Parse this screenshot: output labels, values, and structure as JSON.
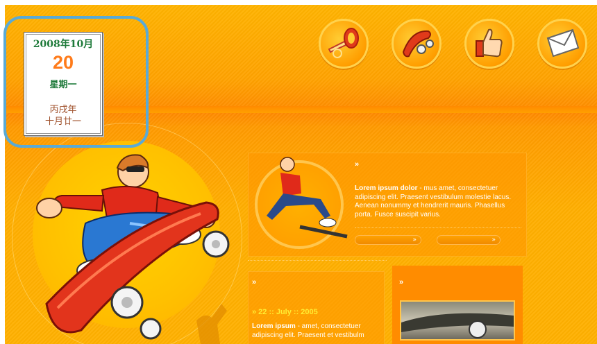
{
  "header": {
    "icons": [
      "trumpet-icon",
      "skateboard-icon",
      "thumbs-up-icon",
      "envelope-icon"
    ]
  },
  "calendar": {
    "year_month": "2008年10月",
    "day": "20",
    "weekday": "星期一",
    "lunar_year": "丙戌年",
    "lunar_date": "十月廿一"
  },
  "content": {
    "block1": {
      "arrow": "»",
      "bold": "Lorem ipsum dolor",
      "text": " - mus amet, consectetuer adipiscing elit. Praesent vestibulum molestie lacus. Aenean nonummy et hendrerit mauris. Phasellus porta. Fusce suscipit varius.",
      "pill1": "»",
      "pill2": "»"
    },
    "block2": {
      "arrow": "»",
      "date": "» 22 :: July :: 2005",
      "bold": "Lorem ipsum",
      "text": " - amet, consectetuer adipiscing elit. Praesent et vestibulm"
    },
    "block3": {
      "arrow": "»"
    }
  },
  "colors": {
    "accent_orange": "#ff9a00",
    "calendar_border": "#5aaad6",
    "calendar_green": "#1e7a3a",
    "calendar_day": "#ff7b1a"
  }
}
